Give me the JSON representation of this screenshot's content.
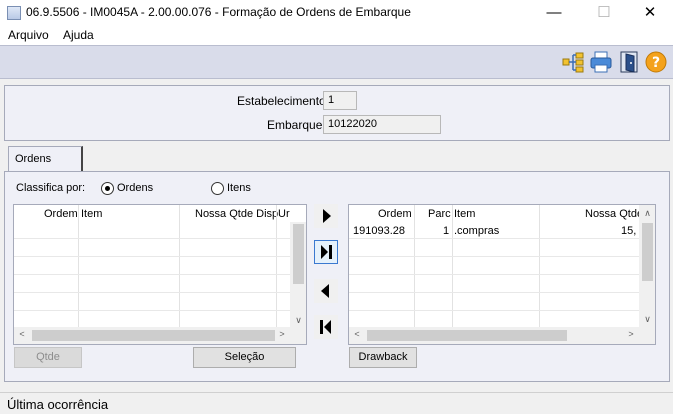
{
  "window": {
    "title": "06.9.5506 - IM0045A - 2.00.00.076 - Formação de Ordens de Embarque",
    "minimize": "—",
    "maximize": "☐",
    "close": "✕"
  },
  "menu": {
    "items": [
      "Arquivo",
      "Ajuda"
    ]
  },
  "toolbar": {
    "icons": [
      "tree-icon",
      "printer-icon",
      "exit-door-icon",
      "help-icon"
    ]
  },
  "header": {
    "estabelecimento_label": "Estabelecimento:",
    "estabelecimento_value": "1",
    "embarque_label": "Embarque:",
    "embarque_value": "10122020"
  },
  "tabs": [
    {
      "label": "Ordens"
    }
  ],
  "classify": {
    "label": "Classifica por:",
    "options": [
      {
        "label": "Ordens",
        "checked": true
      },
      {
        "label": "Itens",
        "checked": false
      }
    ]
  },
  "left_grid": {
    "columns": [
      "Ordem",
      "Item",
      "Nossa Qtde Disp",
      "Ur"
    ],
    "rows": []
  },
  "right_grid": {
    "columns": [
      "Ordem",
      "Parc",
      "Item",
      "Nossa Qtde"
    ],
    "rows": [
      {
        "ordem": "191093.28",
        "parc": "1",
        "item": ".compras",
        "qtde": "15,"
      }
    ]
  },
  "buttons": {
    "qtde": "Qtde",
    "selecao": "Seleção",
    "drawback": "Drawback"
  },
  "status": {
    "text": "Última ocorrência"
  }
}
